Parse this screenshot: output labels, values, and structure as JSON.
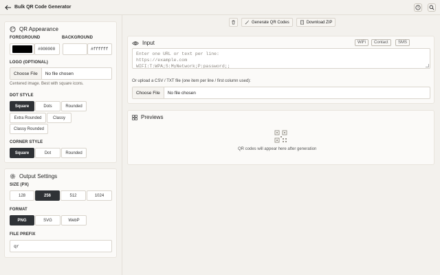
{
  "header": {
    "title": "Bulk QR Code Generator"
  },
  "toolbar": {
    "generate_label": "Generate QR Codes",
    "download_label": "Download ZIP"
  },
  "appearance": {
    "title": "QR Appearance",
    "foreground_label": "FOREGROUND",
    "foreground_value": "#000000",
    "foreground_color": "#000000",
    "background_label": "BACKGROUND",
    "background_value": "#ffffff",
    "background_color": "#ffffff",
    "logo_label": "LOGO (OPTIONAL)",
    "logo_button": "Choose File",
    "logo_status": "No file chosen",
    "logo_hint": "Centered image. Best with square icons.",
    "dot_style_label": "DOT STYLE",
    "dot_styles": [
      "Square",
      "Dots",
      "Rounded",
      "Extra Rounded",
      "Classy",
      "Classy Rounded"
    ],
    "dot_style_selected": "Square",
    "corner_style_label": "CORNER STYLE",
    "corner_styles": [
      "Square",
      "Dot",
      "Rounded"
    ],
    "corner_style_selected": "Square"
  },
  "output": {
    "title": "Output Settings",
    "size_label": "SIZE (PX)",
    "sizes": [
      "128",
      "256",
      "512",
      "1024"
    ],
    "size_selected": "256",
    "format_label": "FORMAT",
    "formats": [
      "PNG",
      "SVG",
      "WebP"
    ],
    "format_selected": "PNG",
    "prefix_label": "FILE PREFIX",
    "prefix_value": "qr"
  },
  "input": {
    "title": "Input",
    "tags": [
      "WiFi",
      "Contact",
      "SMS"
    ],
    "placeholder_lines": [
      "Enter one URL or text per line:",
      "https://example.com",
      "WIFI:T:WPA;S:MyNetwork;P:password;;"
    ],
    "upload_label": "Or upload a CSV / TXT file (one item per line / first column used):",
    "upload_button": "Choose File",
    "upload_status": "No file chosen"
  },
  "previews": {
    "title": "Previews",
    "empty_text": "QR codes will appear here after generation"
  },
  "colors": {
    "active_bg": "#2f3236",
    "page_bg": "#f3f1ed"
  }
}
